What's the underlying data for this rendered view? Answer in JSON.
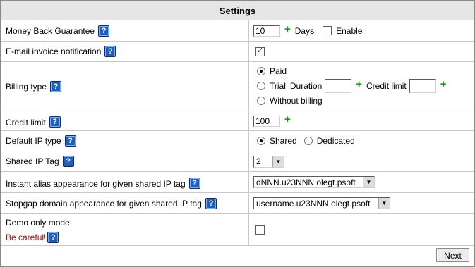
{
  "header": {
    "title": "Settings"
  },
  "rows": {
    "money_back": {
      "label": "Money Back Guarantee",
      "value": "10",
      "unit": "Days",
      "enable_label": "Enable",
      "enabled": false
    },
    "email_invoice": {
      "label": "E-mail invoice notification",
      "checked": true
    },
    "billing": {
      "label": "Billing type",
      "options": {
        "paid": "Paid",
        "trial": "Trial",
        "without": "Without billing"
      },
      "selected": "Paid",
      "duration_label": "Duration",
      "credit_label": "Credit limit",
      "duration_value": "",
      "credit_value": ""
    },
    "credit_limit": {
      "label": "Credit limit",
      "value": "100"
    },
    "ip_type": {
      "label": "Default IP type",
      "options": {
        "shared": "Shared",
        "dedicated": "Dedicated"
      },
      "selected": "Shared"
    },
    "ip_tag": {
      "label": "Shared IP Tag",
      "value": "2"
    },
    "instant_alias": {
      "label": "Instant alias appearance for given shared IP tag",
      "value": "dNNN.u23NNN.olegt.psoft"
    },
    "stopgap": {
      "label": "Stopgap domain appearance for given shared IP tag",
      "value": "username.u23NNN.olegt.psoft"
    },
    "demo": {
      "label": "Demo only mode",
      "warning": "Be careful!",
      "checked": false
    }
  },
  "footer": {
    "next_label": "Next"
  },
  "icons": {
    "help": "help-icon",
    "add": "plus-icon"
  },
  "colors": {
    "help_blue": "#1f5fbf",
    "plus_green": "#1a9a1a",
    "warning_red": "#cc0000",
    "header_bg": "#e6e6e6"
  }
}
